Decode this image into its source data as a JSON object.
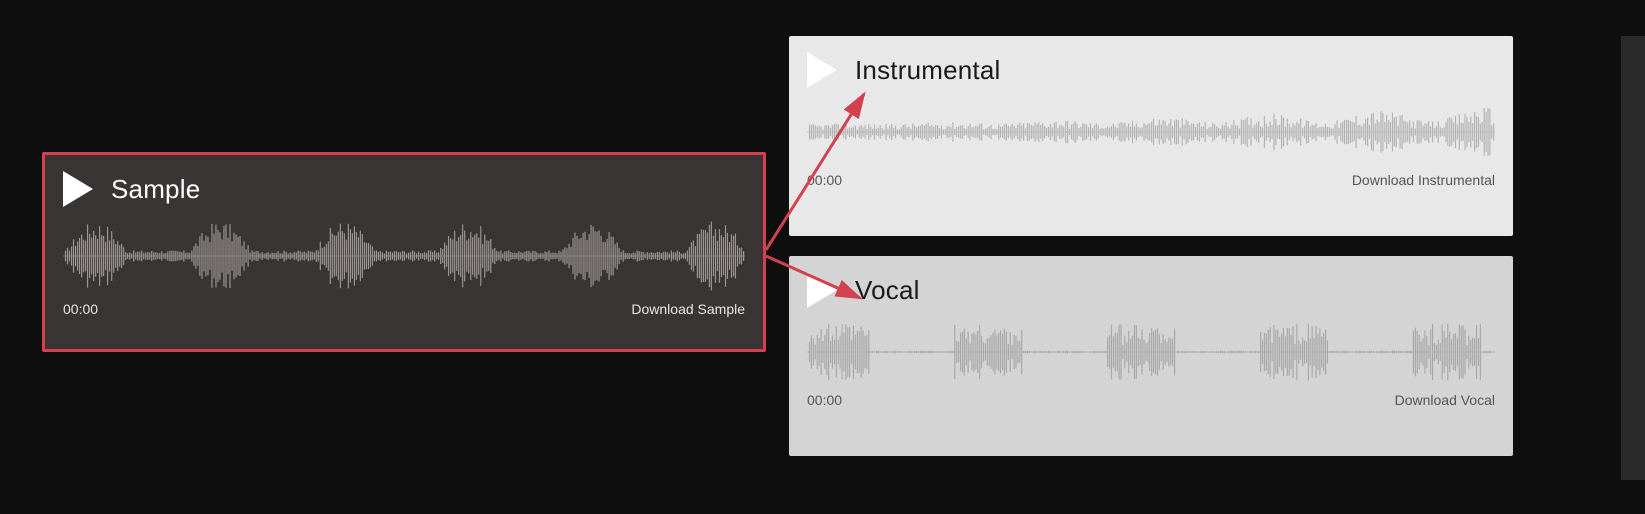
{
  "sample": {
    "title": "Sample",
    "time": "00:00",
    "download": "Download Sample"
  },
  "instrumental": {
    "title": "Instrumental",
    "time": "00:00",
    "download": "Download Instrumental"
  },
  "vocal": {
    "title": "Vocal",
    "time": "00:00",
    "download": "Download Vocal"
  },
  "colors": {
    "highlight_border": "#d4414e",
    "arrow": "#d4414e",
    "dark_card_bg": "#3a3535",
    "light_card_bg": "#e8e8e8",
    "light2_card_bg": "#d4d4d4",
    "page_bg": "#0f0f0f"
  }
}
